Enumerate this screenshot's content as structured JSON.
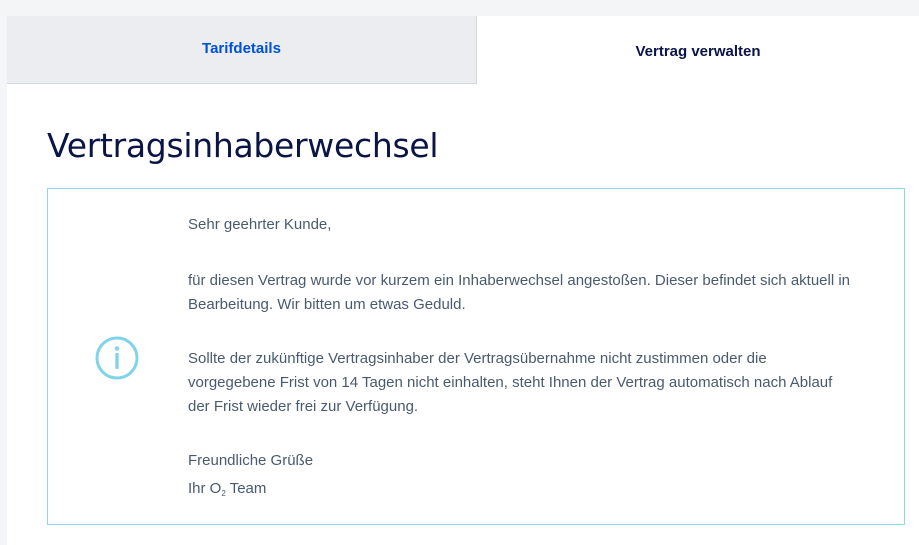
{
  "tabs": [
    {
      "label": "Tarifdetails",
      "active": false
    },
    {
      "label": "Vertrag verwalten",
      "active": true
    }
  ],
  "page": {
    "title": "Vertragsinhaberwechsel"
  },
  "notice": {
    "icon": "info-circle-icon",
    "greeting": "Sehr geehrter Kunde,",
    "paragraph1": "für diesen Vertrag wurde vor kurzem ein Inhaberwechsel angestoßen. Dieser befindet sich aktuell in Bearbeitung. Wir bitten um etwas Geduld.",
    "paragraph2": "Sollte der zukünftige Vertragsinhaber der Vertragsübernahme nicht zustimmen oder die vorgegebene Frist von 14 Tagen nicht einhalten, steht Ihnen der Vertrag automatisch nach Ablauf der Frist wieder frei zur Verfügung.",
    "closing": "Freundliche Grüße",
    "signature_prefix": "Ihr O",
    "signature_subscript": "2",
    "signature_suffix": " Team"
  },
  "colors": {
    "active_tab_text": "#0a1446",
    "inactive_tab_text": "#0050dc",
    "notice_border": "#8fd8ea",
    "info_icon": "#7fd3ea"
  }
}
